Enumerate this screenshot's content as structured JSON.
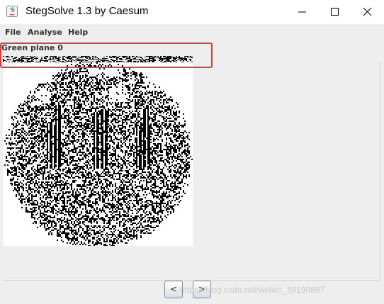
{
  "window": {
    "title": "StegSolve 1.3 by Caesum",
    "controls": {
      "minimize_icon": "minimize-icon",
      "maximize_icon": "maximize-icon",
      "close_icon": "close-icon"
    }
  },
  "menu": {
    "items": [
      {
        "label": "File"
      },
      {
        "label": "Analyse"
      },
      {
        "label": "Help"
      }
    ]
  },
  "viewer": {
    "plane_label": "Green plane 0",
    "annotation_color": "#e53935"
  },
  "navigation": {
    "prev_label": "<",
    "next_label": ">"
  },
  "watermark": "https://blog.csdn.net/weixin_39190897"
}
